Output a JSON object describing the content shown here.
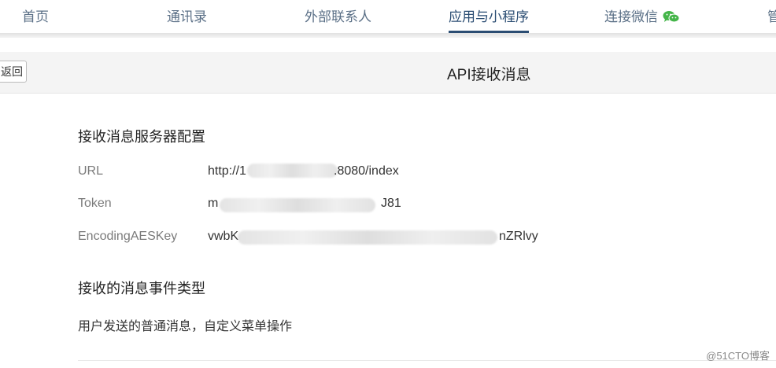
{
  "nav": {
    "items": [
      {
        "label": "首页"
      },
      {
        "label": "通讯录"
      },
      {
        "label": "外部联系人"
      },
      {
        "label": "应用与小程序"
      },
      {
        "label": "连接微信"
      },
      {
        "label": "管"
      }
    ],
    "active_index": 3,
    "active_color": "#2b4d73",
    "wechat_icon_color": "#44b549"
  },
  "titlebar": {
    "back_label": "返回",
    "title": "API接收消息"
  },
  "server_config": {
    "heading": "接收消息服务器配置",
    "rows": [
      {
        "label": "URL",
        "value_start": "http://1",
        "value_end": ".8080/index"
      },
      {
        "label": "Token",
        "value_start": "m",
        "value_end": "J81"
      },
      {
        "label": "EncodingAESKey",
        "value_start": "vwbK",
        "value_end": "nZRlvy"
      }
    ]
  },
  "event_types": {
    "heading": "接收的消息事件类型",
    "description": "用户发送的普通消息，自定义菜单操作"
  },
  "watermark": "@51CTO博客"
}
